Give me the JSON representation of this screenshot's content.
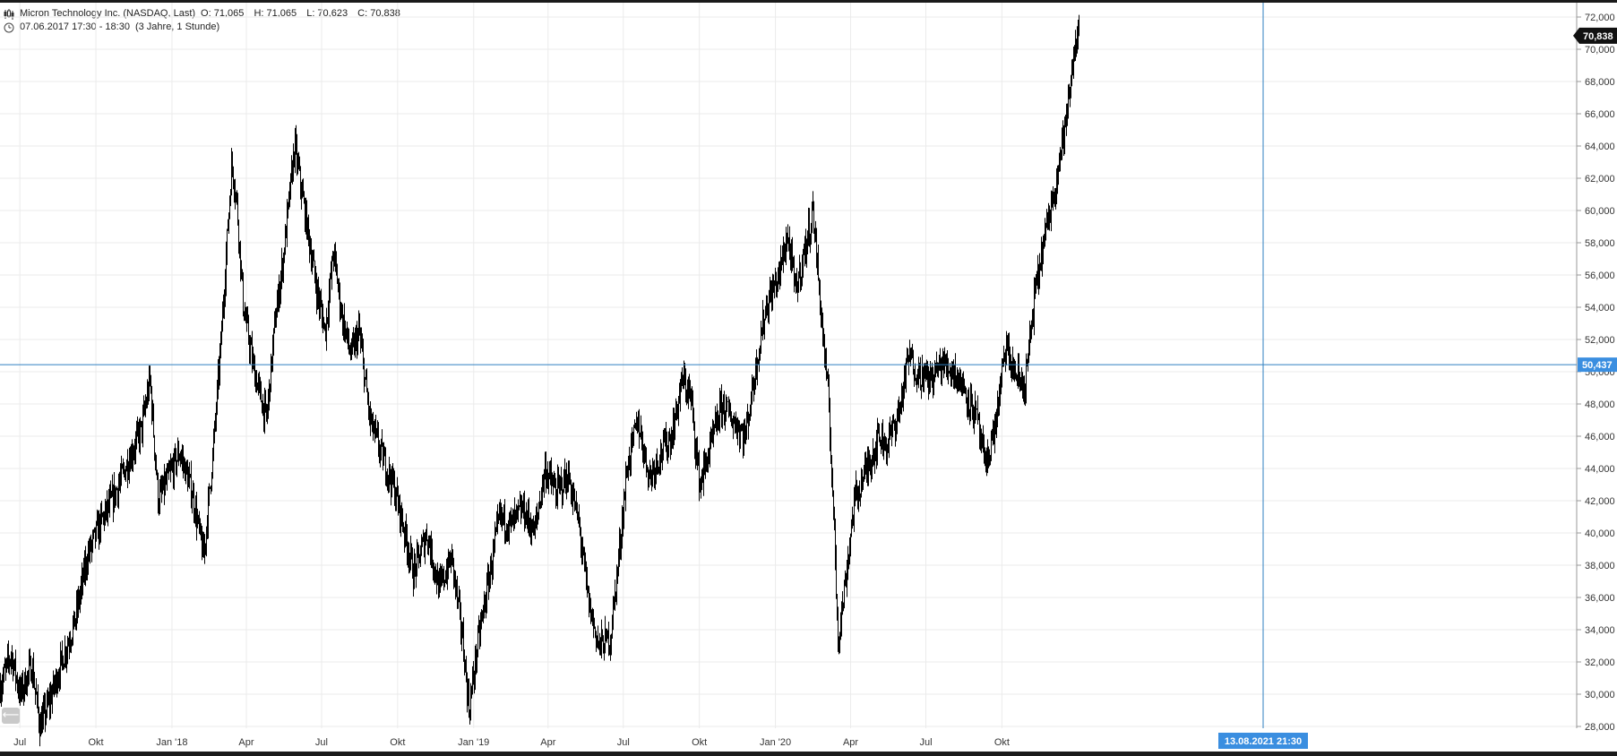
{
  "header": {
    "title": "Micron Technology Inc. (NASDAQ, Last)",
    "open": "O: 71,065",
    "high": "H: 71,065",
    "low": "L: 70,623",
    "close": "C: 70,838",
    "period": "07.06.2017 17:30 - 18:30",
    "range": "(3 Jahre, 1 Stunde)"
  },
  "colors": {
    "candle": "#000000",
    "crosshair": "#2f7fc1",
    "crosshair_label": "#3a8ee0",
    "last_price_label": "#111111",
    "grid": "#ebebeb"
  },
  "icons": {
    "chart": "candlestick-icon",
    "time": "clock-icon",
    "back": "back-arrow-icon"
  },
  "chart_data": {
    "type": "line",
    "title": "Micron Technology Inc. (NASDAQ, Last)",
    "xlabel": "",
    "ylabel": "",
    "ylim": [
      27,
      73
    ],
    "y_ticks": [
      "28,000",
      "30,000",
      "32,000",
      "34,000",
      "36,000",
      "38,000",
      "40,000",
      "42,000",
      "44,000",
      "46,000",
      "48,000",
      "50,000",
      "52,000",
      "54,000",
      "56,000",
      "58,000",
      "60,000",
      "62,000",
      "64,000",
      "66,000",
      "68,000",
      "70,000",
      "72,000"
    ],
    "x_ticks": [
      {
        "date": "2017-07-01",
        "label": "Jul"
      },
      {
        "date": "2017-10-01",
        "label": "Okt"
      },
      {
        "date": "2018-01-01",
        "label": "Jan '18"
      },
      {
        "date": "2018-04-01",
        "label": "Apr"
      },
      {
        "date": "2018-07-01",
        "label": "Jul"
      },
      {
        "date": "2018-10-01",
        "label": "Okt"
      },
      {
        "date": "2019-01-01",
        "label": "Jan '19"
      },
      {
        "date": "2019-04-01",
        "label": "Apr"
      },
      {
        "date": "2019-07-01",
        "label": "Jul"
      },
      {
        "date": "2019-10-01",
        "label": "Okt"
      },
      {
        "date": "2020-01-01",
        "label": "Jan '20"
      },
      {
        "date": "2020-04-01",
        "label": "Apr"
      },
      {
        "date": "2020-07-01",
        "label": "Jul"
      },
      {
        "date": "2020-10-01",
        "label": "Okt"
      }
    ],
    "grid": true,
    "last_price": 70.838,
    "last_price_label": "70,838",
    "crosshair": {
      "price": 50.437,
      "price_label": "50,437",
      "date": "2021-08-13",
      "date_label": "13.08.2021 21:30"
    },
    "series": [
      {
        "name": "",
        "points": [
          [
            "2017-06-07",
            30.5
          ],
          [
            "2017-06-20",
            32.5
          ],
          [
            "2017-07-01",
            30.0
          ],
          [
            "2017-07-15",
            31.8
          ],
          [
            "2017-07-25",
            28.0
          ],
          [
            "2017-08-05",
            29.5
          ],
          [
            "2017-08-20",
            32.0
          ],
          [
            "2017-09-05",
            34.5
          ],
          [
            "2017-09-20",
            38.5
          ],
          [
            "2017-10-05",
            40.5
          ],
          [
            "2017-10-20",
            42.0
          ],
          [
            "2017-11-05",
            44.0
          ],
          [
            "2017-11-25",
            46.5
          ],
          [
            "2017-12-05",
            49.5
          ],
          [
            "2017-12-15",
            42.0
          ],
          [
            "2017-12-28",
            43.5
          ],
          [
            "2018-01-10",
            45.0
          ],
          [
            "2018-01-25",
            42.5
          ],
          [
            "2018-02-08",
            38.5
          ],
          [
            "2018-02-20",
            45.5
          ],
          [
            "2018-03-01",
            52.0
          ],
          [
            "2018-03-08",
            58.0
          ],
          [
            "2018-03-14",
            63.0
          ],
          [
            "2018-03-20",
            60.5
          ],
          [
            "2018-03-28",
            54.0
          ],
          [
            "2018-04-10",
            50.0
          ],
          [
            "2018-04-25",
            47.0
          ],
          [
            "2018-05-05",
            53.0
          ],
          [
            "2018-05-15",
            57.0
          ],
          [
            "2018-05-29",
            64.0
          ],
          [
            "2018-06-10",
            60.0
          ],
          [
            "2018-06-25",
            55.0
          ],
          [
            "2018-07-05",
            52.5
          ],
          [
            "2018-07-15",
            57.5
          ],
          [
            "2018-07-25",
            53.5
          ],
          [
            "2018-08-05",
            51.0
          ],
          [
            "2018-08-15",
            52.5
          ],
          [
            "2018-08-28",
            47.0
          ],
          [
            "2018-09-10",
            45.0
          ],
          [
            "2018-09-25",
            43.0
          ],
          [
            "2018-10-05",
            41.0
          ],
          [
            "2018-10-20",
            37.5
          ],
          [
            "2018-11-05",
            40.0
          ],
          [
            "2018-11-20",
            36.5
          ],
          [
            "2018-12-05",
            38.5
          ],
          [
            "2018-12-18",
            33.5
          ],
          [
            "2018-12-26",
            29.0
          ],
          [
            "2019-01-05",
            33.0
          ],
          [
            "2019-01-20",
            37.5
          ],
          [
            "2019-02-01",
            41.0
          ],
          [
            "2019-02-15",
            40.5
          ],
          [
            "2019-03-01",
            41.5
          ],
          [
            "2019-03-15",
            40.0
          ],
          [
            "2019-03-28",
            44.0
          ],
          [
            "2019-04-10",
            42.5
          ],
          [
            "2019-04-25",
            43.5
          ],
          [
            "2019-05-08",
            40.5
          ],
          [
            "2019-05-20",
            35.5
          ],
          [
            "2019-06-01",
            33.0
          ],
          [
            "2019-06-15",
            33.5
          ],
          [
            "2019-06-25",
            38.5
          ],
          [
            "2019-07-05",
            44.0
          ],
          [
            "2019-07-18",
            47.0
          ],
          [
            "2019-08-01",
            43.5
          ],
          [
            "2019-08-15",
            45.0
          ],
          [
            "2019-08-28",
            46.0
          ],
          [
            "2019-09-10",
            49.5
          ],
          [
            "2019-09-20",
            48.5
          ],
          [
            "2019-10-01",
            43.0
          ],
          [
            "2019-10-15",
            45.5
          ],
          [
            "2019-10-28",
            48.0
          ],
          [
            "2019-11-10",
            47.0
          ],
          [
            "2019-11-25",
            46.0
          ],
          [
            "2019-12-10",
            51.0
          ],
          [
            "2019-12-20",
            54.0
          ],
          [
            "2020-01-05",
            56.0
          ],
          [
            "2020-01-15",
            58.5
          ],
          [
            "2020-01-25",
            55.0
          ],
          [
            "2020-02-05",
            57.5
          ],
          [
            "2020-02-15",
            60.0
          ],
          [
            "2020-02-25",
            53.5
          ],
          [
            "2020-03-05",
            48.0
          ],
          [
            "2020-03-12",
            40.0
          ],
          [
            "2020-03-16",
            33.5
          ],
          [
            "2020-03-23",
            36.0
          ],
          [
            "2020-04-05",
            42.0
          ],
          [
            "2020-04-20",
            44.0
          ],
          [
            "2020-05-05",
            46.0
          ],
          [
            "2020-05-15",
            45.5
          ],
          [
            "2020-05-29",
            47.5
          ],
          [
            "2020-06-10",
            51.0
          ],
          [
            "2020-06-20",
            50.0
          ],
          [
            "2020-07-05",
            49.5
          ],
          [
            "2020-07-20",
            50.5
          ],
          [
            "2020-08-05",
            50.0
          ],
          [
            "2020-08-20",
            48.5
          ],
          [
            "2020-09-01",
            47.0
          ],
          [
            "2020-09-10",
            44.0
          ],
          [
            "2020-09-22",
            46.5
          ],
          [
            "2020-10-05",
            51.5
          ],
          [
            "2020-10-15",
            50.0
          ],
          [
            "2020-10-28",
            49.0
          ],
          [
            "2020-11-10",
            55.0
          ],
          [
            "2020-11-20",
            58.0
          ],
          [
            "2020-11-28",
            60.0
          ],
          [
            "2020-12-10",
            63.5
          ],
          [
            "2020-12-20",
            66.5
          ],
          [
            "2020-12-28",
            70.5
          ],
          [
            "2021-01-02",
            70.84
          ]
        ]
      }
    ]
  },
  "controls": {
    "back_symbol": "⟵"
  }
}
